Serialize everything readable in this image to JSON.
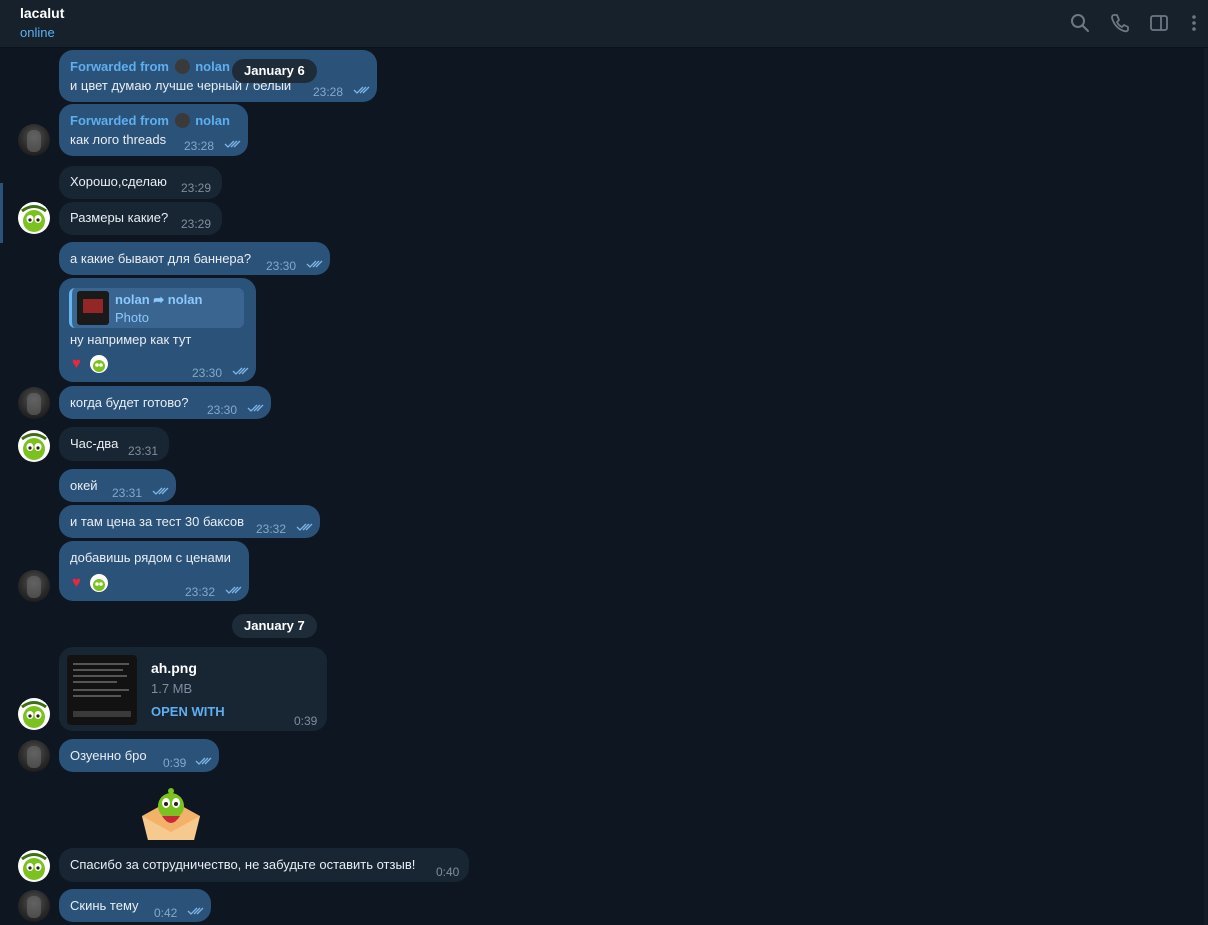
{
  "header": {
    "title": "lacalut",
    "status": "online",
    "icons": [
      "search-icon",
      "phone-icon",
      "sidebar-toggle-icon",
      "more-vertical-icon"
    ]
  },
  "dates": {
    "jan6": "January 6",
    "jan7": "January 7"
  },
  "messages": {
    "m1": {
      "fwd_prefix": "Forwarded from",
      "fwd_name": "nolan",
      "text": "и цвет думаю лучше черный / белый",
      "time": "23:28"
    },
    "m2": {
      "fwd_prefix": "Forwarded from",
      "fwd_name": "nolan",
      "text": "как лого threads",
      "time": "23:28"
    },
    "m3": {
      "text": "Хорошо,сделаю",
      "time": "23:29"
    },
    "m4": {
      "text": "Размеры какие?",
      "time": "23:29"
    },
    "m5": {
      "text": "а какие бывают для баннера?",
      "time": "23:30"
    },
    "m6": {
      "reply_name": "nolan ➦ nolan",
      "reply_sub": "Photo",
      "text": "ну например как тут",
      "time": "23:30"
    },
    "m7": {
      "text": "когда будет готово?",
      "time": "23:30"
    },
    "m8": {
      "text": "Час-два",
      "time": "23:31"
    },
    "m9": {
      "text": "окей",
      "time": "23:31"
    },
    "m10": {
      "text": "и там цена за тест 30 баксов",
      "time": "23:32"
    },
    "m11": {
      "text": "добавишь рядом с ценами",
      "time": "23:32"
    },
    "m12": {
      "file_name": "ah.png",
      "file_size": "1.7 MB",
      "action": "OPEN WITH",
      "time": "0:39"
    },
    "m13": {
      "text": "Озуенно бро",
      "time": "0:39"
    },
    "m14": {
      "text": "Спасибо за сотрудничество, не забудьте оставить отзыв!",
      "time": "0:40"
    },
    "m15": {
      "text": "Скинь тему",
      "time": "0:42"
    }
  },
  "colors": {
    "background": "#0e1621",
    "incoming_bubble": "#182533",
    "outgoing_bubble": "#2b5278",
    "accent": "#5eaff0",
    "heart": "#e8293b"
  }
}
